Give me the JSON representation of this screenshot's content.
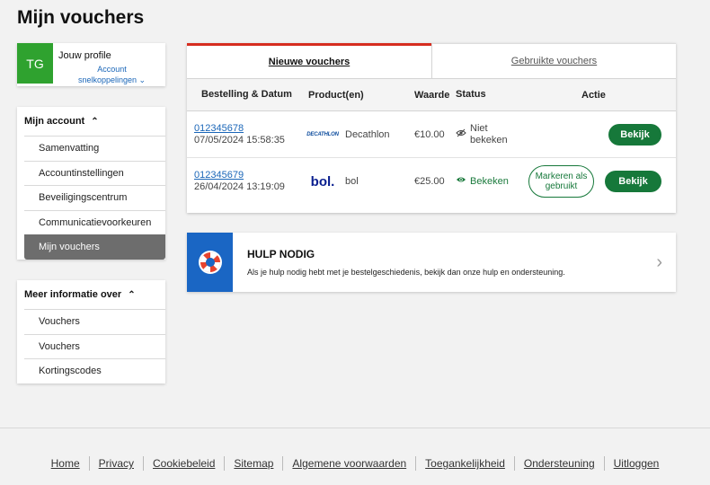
{
  "page": {
    "title": "Mijn vouchers"
  },
  "profile": {
    "initials": "TG",
    "name": "Jouw profile",
    "link_line1": "Account",
    "link_line2": "snelkoppelingen ⌄"
  },
  "account_menu": {
    "heading": "Mijn account",
    "items": [
      "Samenvatting",
      "Accountinstellingen",
      "Beveiligingscentrum",
      "Communicatievoorkeuren",
      "Mijn vouchers"
    ],
    "active_index": 4
  },
  "info_menu": {
    "heading": "Meer informatie over",
    "items": [
      "Vouchers",
      "Vouchers",
      "Kortingscodes"
    ]
  },
  "tabs": [
    "Nieuwe vouchers",
    "Gebruikte vouchers"
  ],
  "table": {
    "headers": [
      "Bestelling & Datum",
      "Product(en)",
      "Waarde",
      "Status",
      "Actie"
    ],
    "rows": [
      {
        "order": "012345678",
        "date": "07/05/2024 15:58:35",
        "logo": "DECATHLON",
        "product": "Decathlon",
        "value": "€10.00",
        "status_line1": "Niet",
        "status_line2": "bekeken",
        "status_icon": "eye-slash-icon",
        "mark_label": "",
        "view_label": "Bekijk"
      },
      {
        "order": "012345679",
        "date": "26/04/2024 13:19:09",
        "logo": "bol.",
        "product": "bol",
        "value": "€25.00",
        "status_line1": "Bekeken",
        "status_line2": "",
        "status_icon": "eye-icon",
        "mark_label": "Markeren als gebruikt",
        "view_label": "Bekijk"
      }
    ]
  },
  "help": {
    "title": "HULP NODIG",
    "description": "Als je hulp nodig hebt met je bestelgeschiedenis, bekijk dan onze hulp en ondersteuning."
  },
  "footer": [
    "Home",
    "Privacy",
    "Cookiebeleid",
    "Sitemap",
    "Algemene voorwaarden",
    "Toegankelijkheid",
    "Ondersteuning",
    "Uitloggen"
  ],
  "colors": {
    "accent_green": "#16783a",
    "tab_red": "#d62d20",
    "help_blue": "#1a66c4",
    "link_blue": "#1a66b8",
    "avatar_green": "#2fa22f"
  }
}
